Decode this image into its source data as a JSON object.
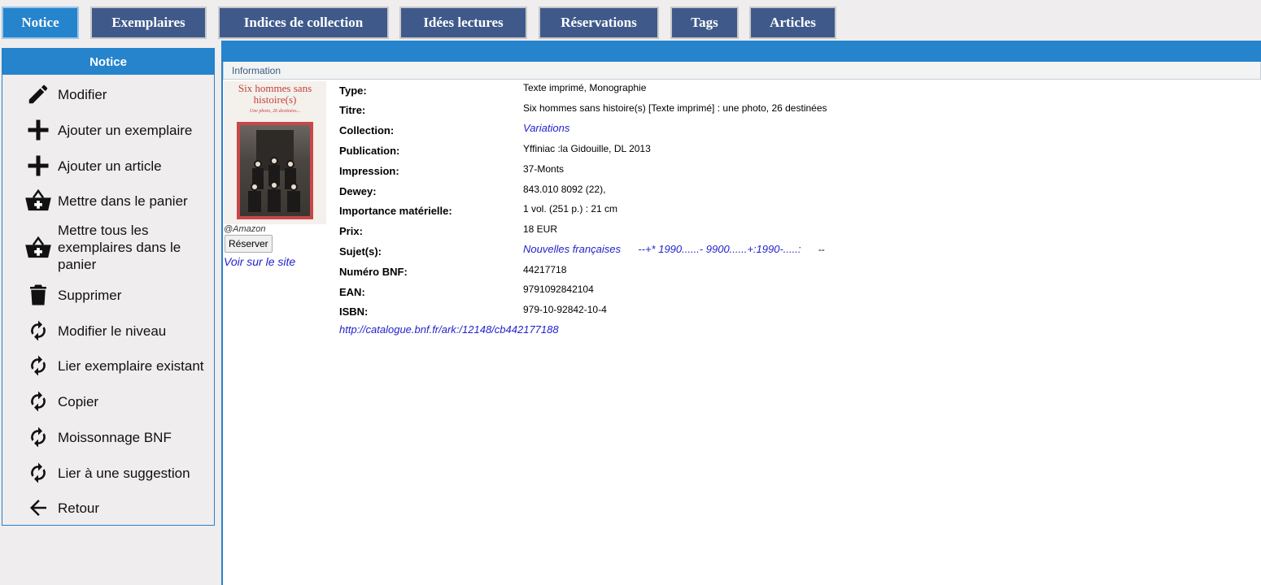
{
  "tabs": [
    {
      "label": "Notice",
      "active": true
    },
    {
      "label": "Exemplaires"
    },
    {
      "label": "Indices de collection"
    },
    {
      "label": "Idées lectures"
    },
    {
      "label": "Réservations"
    },
    {
      "label": "Tags"
    },
    {
      "label": "Articles"
    }
  ],
  "sidebar": {
    "title": "Notice",
    "items": [
      {
        "label": "Modifier",
        "icon": "pencil-icon"
      },
      {
        "label": "Ajouter un exemplaire",
        "icon": "plus-icon"
      },
      {
        "label": "Ajouter un article",
        "icon": "plus-icon"
      },
      {
        "label": "Mettre dans le panier",
        "icon": "basket-add-icon"
      },
      {
        "label": "Mettre tous les exemplaires dans le panier",
        "icon": "basket-add-icon"
      },
      {
        "label": "Supprimer",
        "icon": "trash-icon"
      },
      {
        "label": "Modifier le niveau",
        "icon": "refresh-icon"
      },
      {
        "label": "Lier exemplaire existant",
        "icon": "refresh-icon"
      },
      {
        "label": "Copier",
        "icon": "refresh-icon"
      },
      {
        "label": "Moissonnage BNF",
        "icon": "refresh-icon"
      },
      {
        "label": "Lier à une suggestion",
        "icon": "refresh-icon"
      },
      {
        "label": "Retour",
        "icon": "arrow-left-icon"
      }
    ]
  },
  "info": {
    "header": "Information",
    "cover": {
      "title": "Six hommes sans histoire(s)",
      "subtitle": "Une photo, 26 destinées...",
      "source": "@Amazon"
    },
    "reserve_label": "Réserver",
    "site_link": "Voir sur le site",
    "fields": [
      {
        "label": "Type:",
        "value": "Texte imprimé, Monographie"
      },
      {
        "label": "Titre:",
        "value": "Six hommes sans histoire(s) [Texte imprimé] : une photo, 26 destinées"
      },
      {
        "label": "Collection:",
        "value": "Variations",
        "link": true
      },
      {
        "label": "Publication:",
        "value": "Yffiniac :la Gidouille, DL 2013"
      },
      {
        "label": "Impression:",
        "value": "37-Monts"
      },
      {
        "label": "Dewey:",
        "value": "843.010 8092 (22),"
      },
      {
        "label": "Importance matérielle:",
        "value": "1 vol. (251 p.) : 21 cm"
      },
      {
        "label": "Prix:",
        "value": "18 EUR"
      },
      {
        "label": "Sujet(s):",
        "subject_link": "Nouvelles françaises",
        "subject_rest": "--+* 1990......- 9900......+:1990-.....:",
        "subject_tail": "--"
      },
      {
        "label": "Numéro BNF:",
        "value": "44217718"
      },
      {
        "label": "EAN:",
        "value": "9791092842104"
      },
      {
        "label": "ISBN:",
        "value": "979-10-92842-10-4"
      }
    ],
    "bnf_url": "http://catalogue.bnf.fr/ark:/12148/cb442177188"
  }
}
